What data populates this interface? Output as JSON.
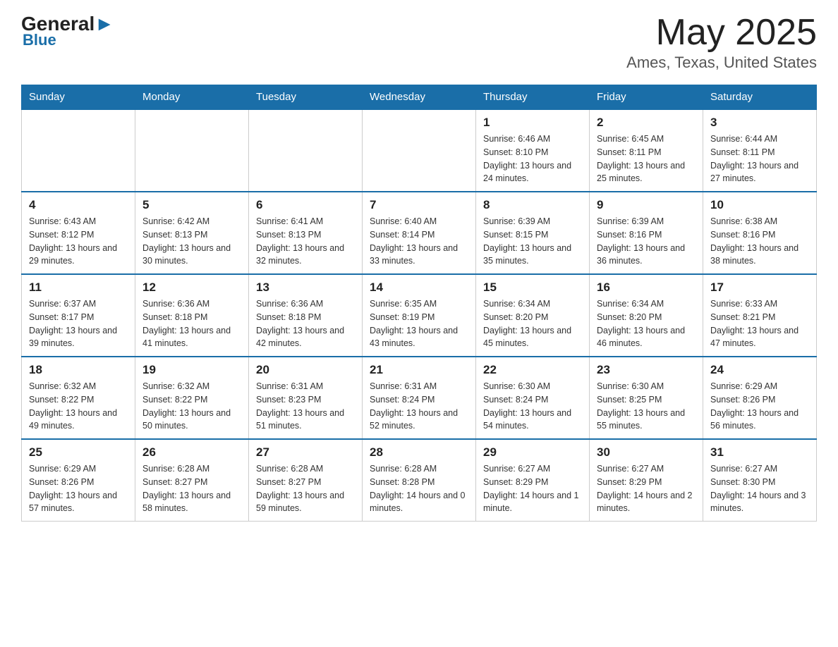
{
  "header": {
    "logo_general": "General",
    "logo_blue": "Blue",
    "month_title": "May 2025",
    "location": "Ames, Texas, United States"
  },
  "weekdays": [
    "Sunday",
    "Monday",
    "Tuesday",
    "Wednesday",
    "Thursday",
    "Friday",
    "Saturday"
  ],
  "weeks": [
    [
      {
        "day": "",
        "info": ""
      },
      {
        "day": "",
        "info": ""
      },
      {
        "day": "",
        "info": ""
      },
      {
        "day": "",
        "info": ""
      },
      {
        "day": "1",
        "info": "Sunrise: 6:46 AM\nSunset: 8:10 PM\nDaylight: 13 hours and 24 minutes."
      },
      {
        "day": "2",
        "info": "Sunrise: 6:45 AM\nSunset: 8:11 PM\nDaylight: 13 hours and 25 minutes."
      },
      {
        "day": "3",
        "info": "Sunrise: 6:44 AM\nSunset: 8:11 PM\nDaylight: 13 hours and 27 minutes."
      }
    ],
    [
      {
        "day": "4",
        "info": "Sunrise: 6:43 AM\nSunset: 8:12 PM\nDaylight: 13 hours and 29 minutes."
      },
      {
        "day": "5",
        "info": "Sunrise: 6:42 AM\nSunset: 8:13 PM\nDaylight: 13 hours and 30 minutes."
      },
      {
        "day": "6",
        "info": "Sunrise: 6:41 AM\nSunset: 8:13 PM\nDaylight: 13 hours and 32 minutes."
      },
      {
        "day": "7",
        "info": "Sunrise: 6:40 AM\nSunset: 8:14 PM\nDaylight: 13 hours and 33 minutes."
      },
      {
        "day": "8",
        "info": "Sunrise: 6:39 AM\nSunset: 8:15 PM\nDaylight: 13 hours and 35 minutes."
      },
      {
        "day": "9",
        "info": "Sunrise: 6:39 AM\nSunset: 8:16 PM\nDaylight: 13 hours and 36 minutes."
      },
      {
        "day": "10",
        "info": "Sunrise: 6:38 AM\nSunset: 8:16 PM\nDaylight: 13 hours and 38 minutes."
      }
    ],
    [
      {
        "day": "11",
        "info": "Sunrise: 6:37 AM\nSunset: 8:17 PM\nDaylight: 13 hours and 39 minutes."
      },
      {
        "day": "12",
        "info": "Sunrise: 6:36 AM\nSunset: 8:18 PM\nDaylight: 13 hours and 41 minutes."
      },
      {
        "day": "13",
        "info": "Sunrise: 6:36 AM\nSunset: 8:18 PM\nDaylight: 13 hours and 42 minutes."
      },
      {
        "day": "14",
        "info": "Sunrise: 6:35 AM\nSunset: 8:19 PM\nDaylight: 13 hours and 43 minutes."
      },
      {
        "day": "15",
        "info": "Sunrise: 6:34 AM\nSunset: 8:20 PM\nDaylight: 13 hours and 45 minutes."
      },
      {
        "day": "16",
        "info": "Sunrise: 6:34 AM\nSunset: 8:20 PM\nDaylight: 13 hours and 46 minutes."
      },
      {
        "day": "17",
        "info": "Sunrise: 6:33 AM\nSunset: 8:21 PM\nDaylight: 13 hours and 47 minutes."
      }
    ],
    [
      {
        "day": "18",
        "info": "Sunrise: 6:32 AM\nSunset: 8:22 PM\nDaylight: 13 hours and 49 minutes."
      },
      {
        "day": "19",
        "info": "Sunrise: 6:32 AM\nSunset: 8:22 PM\nDaylight: 13 hours and 50 minutes."
      },
      {
        "day": "20",
        "info": "Sunrise: 6:31 AM\nSunset: 8:23 PM\nDaylight: 13 hours and 51 minutes."
      },
      {
        "day": "21",
        "info": "Sunrise: 6:31 AM\nSunset: 8:24 PM\nDaylight: 13 hours and 52 minutes."
      },
      {
        "day": "22",
        "info": "Sunrise: 6:30 AM\nSunset: 8:24 PM\nDaylight: 13 hours and 54 minutes."
      },
      {
        "day": "23",
        "info": "Sunrise: 6:30 AM\nSunset: 8:25 PM\nDaylight: 13 hours and 55 minutes."
      },
      {
        "day": "24",
        "info": "Sunrise: 6:29 AM\nSunset: 8:26 PM\nDaylight: 13 hours and 56 minutes."
      }
    ],
    [
      {
        "day": "25",
        "info": "Sunrise: 6:29 AM\nSunset: 8:26 PM\nDaylight: 13 hours and 57 minutes."
      },
      {
        "day": "26",
        "info": "Sunrise: 6:28 AM\nSunset: 8:27 PM\nDaylight: 13 hours and 58 minutes."
      },
      {
        "day": "27",
        "info": "Sunrise: 6:28 AM\nSunset: 8:27 PM\nDaylight: 13 hours and 59 minutes."
      },
      {
        "day": "28",
        "info": "Sunrise: 6:28 AM\nSunset: 8:28 PM\nDaylight: 14 hours and 0 minutes."
      },
      {
        "day": "29",
        "info": "Sunrise: 6:27 AM\nSunset: 8:29 PM\nDaylight: 14 hours and 1 minute."
      },
      {
        "day": "30",
        "info": "Sunrise: 6:27 AM\nSunset: 8:29 PM\nDaylight: 14 hours and 2 minutes."
      },
      {
        "day": "31",
        "info": "Sunrise: 6:27 AM\nSunset: 8:30 PM\nDaylight: 14 hours and 3 minutes."
      }
    ]
  ]
}
